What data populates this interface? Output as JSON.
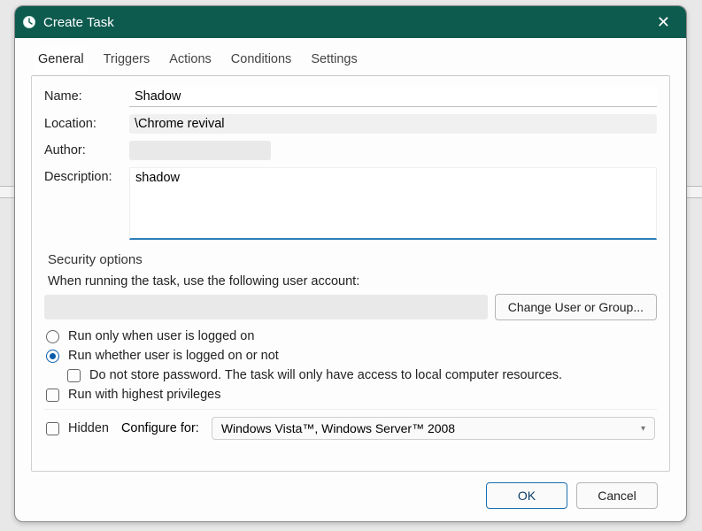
{
  "window": {
    "title": "Create Task"
  },
  "tabs": [
    "General",
    "Triggers",
    "Actions",
    "Conditions",
    "Settings"
  ],
  "activeTab": 0,
  "general": {
    "labels": {
      "name": "Name:",
      "location": "Location:",
      "author": "Author:",
      "description": "Description:"
    },
    "name": "Shadow",
    "location": "\\Chrome revival",
    "author": "",
    "description": "shadow"
  },
  "security": {
    "title": "Security options",
    "runAsLabel": "When running the task, use the following user account:",
    "userAccount": "",
    "changeUserBtn": "Change User or Group...",
    "runLoggedOn": "Run only when user is logged on",
    "runLoggedOnOrNot": "Run whether user is logged on or not",
    "noStorePwd": "Do not store password.  The task will only have access to local computer resources.",
    "highestPriv": "Run with highest privileges",
    "selected": "runLoggedOnOrNot",
    "noStorePwdChecked": false,
    "highestPrivChecked": false
  },
  "bottom": {
    "hidden": "Hidden",
    "hiddenChecked": false,
    "configureFor": "Configure for:",
    "configureForValue": "Windows Vista™, Windows Server™ 2008"
  },
  "footer": {
    "ok": "OK",
    "cancel": "Cancel"
  }
}
